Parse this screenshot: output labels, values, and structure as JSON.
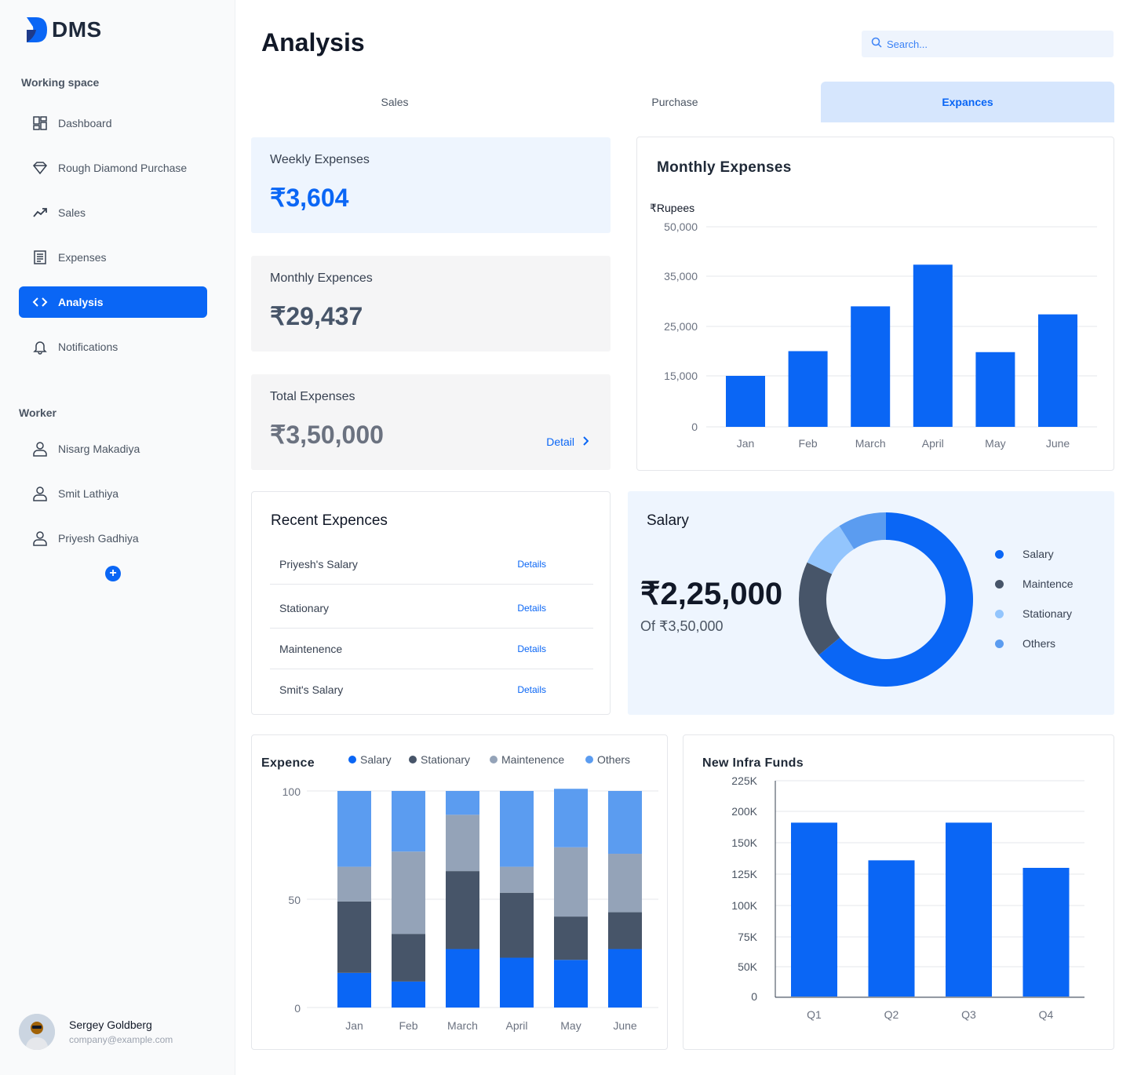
{
  "app": {
    "logo": "DMS"
  },
  "sidebar": {
    "working_space_title": "Working space",
    "items": [
      {
        "label": "Dashboard",
        "icon": "dashboard-icon"
      },
      {
        "label": "Rough Diamond Purchase",
        "icon": "diamond-icon"
      },
      {
        "label": "Sales",
        "icon": "trend-icon"
      },
      {
        "label": "Expenses",
        "icon": "receipt-icon"
      },
      {
        "label": "Analysis",
        "icon": "code-icon",
        "active": true
      },
      {
        "label": "Notifications",
        "icon": "bell-icon"
      }
    ],
    "worker_title": "Worker",
    "workers": [
      "Nisarg Makadiya",
      "Smit Lathiya",
      "Priyesh Gadhiya"
    ],
    "add_icon": "plus-icon"
  },
  "user": {
    "name": "Sergey Goldberg",
    "email": "company@example.com"
  },
  "header": {
    "title": "Analysis",
    "search_placeholder": "Search..."
  },
  "tabs": [
    {
      "label": "Sales"
    },
    {
      "label": "Purchase"
    },
    {
      "label": "Expances",
      "active": true
    }
  ],
  "stats": {
    "weekly": {
      "label": "Weekly Expenses",
      "value": "₹3,604"
    },
    "monthly": {
      "label": "Monthly Expences",
      "value": "₹29,437"
    },
    "total": {
      "label": "Total Expenses",
      "value": "₹3,50,000",
      "link": "Detail"
    }
  },
  "recent": {
    "title": "Recent Expences",
    "rows": [
      {
        "name": "Priyesh's Salary",
        "link": "Details"
      },
      {
        "name": "Stationary",
        "link": "Details"
      },
      {
        "name": "Maintenence",
        "link": "Details"
      },
      {
        "name": "Smit's Salary",
        "link": "Details"
      }
    ]
  },
  "salary": {
    "title": "Salary",
    "value": "₹2,25,000",
    "of_text": "Of ₹3,50,000",
    "legend": [
      {
        "label": "Salary",
        "color": "#0a66f5"
      },
      {
        "label": "Maintence",
        "color": "#475569"
      },
      {
        "label": "Stationary",
        "color": "#93c5fd"
      },
      {
        "label": "Others",
        "color": "#5b9cf0"
      }
    ]
  },
  "colors": {
    "accent": "#0a66f5",
    "slate": "#475569",
    "gray": "#94a3b8",
    "light_blue": "#5b9cf0"
  },
  "chart_data": [
    {
      "type": "bar",
      "title": "Monthly Expenses",
      "ylabel": "₹Rupees",
      "categories": [
        "Jan",
        "Feb",
        "March",
        "April",
        "May",
        "June"
      ],
      "values": [
        15000,
        20000,
        29000,
        38500,
        19800,
        27400
      ],
      "yticks": [
        "50,000",
        "35,000",
        "25,000",
        "15,000",
        "0"
      ],
      "grid": true
    },
    {
      "type": "pie",
      "title": "Salary",
      "labels": [
        "Salary",
        "Maintence",
        "Stationary",
        "Others"
      ],
      "values": [
        64,
        18,
        9,
        9
      ]
    },
    {
      "type": "bar",
      "stacked": true,
      "title": "Expence",
      "categories": [
        "Jan",
        "Feb",
        "March",
        "April",
        "May",
        "June"
      ],
      "series": [
        {
          "name": "Salary",
          "values": [
            16,
            12,
            27,
            23,
            22,
            27
          ]
        },
        {
          "name": "Stationary",
          "values": [
            33,
            22,
            36,
            30,
            20,
            17
          ]
        },
        {
          "name": "Maintenence",
          "values": [
            16,
            38,
            26,
            12,
            32,
            27
          ]
        },
        {
          "name": "Others",
          "values": [
            35,
            28,
            11,
            35,
            27,
            29
          ]
        }
      ],
      "yticks": [
        "100",
        "50",
        "0"
      ],
      "ylim": [
        0,
        100
      ],
      "legend_position": "top"
    },
    {
      "type": "bar",
      "title": "New Infra Funds",
      "categories": [
        "Q1",
        "Q2",
        "Q3",
        "Q4"
      ],
      "values": [
        182000,
        136000,
        182000,
        130000
      ],
      "yticks": [
        "225K",
        "200K",
        "150K",
        "125K",
        "100K",
        "75K",
        "50K",
        "0"
      ],
      "grid": true
    }
  ]
}
